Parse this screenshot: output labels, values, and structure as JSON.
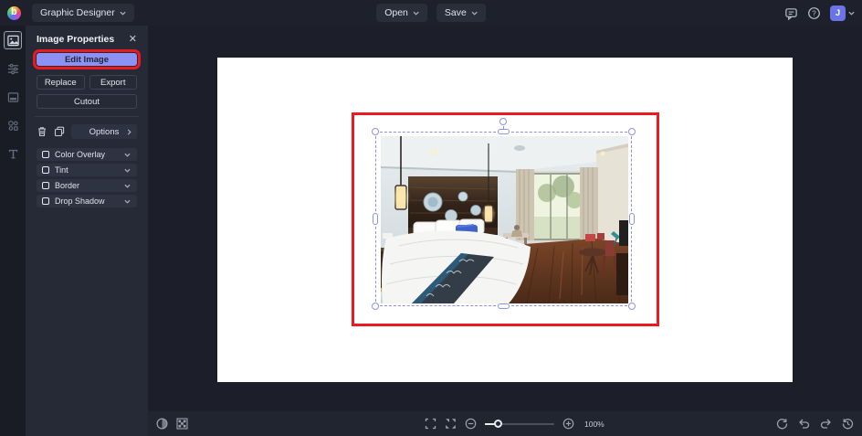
{
  "topbar": {
    "mode_label": "Graphic Designer",
    "open_label": "Open",
    "save_label": "Save",
    "avatar_initial": "J"
  },
  "sidebar": {
    "items": [
      {
        "name": "image-manager",
        "active": true
      },
      {
        "name": "edit",
        "active": false
      },
      {
        "name": "image-library",
        "active": false
      },
      {
        "name": "graphics",
        "active": false
      },
      {
        "name": "text",
        "active": false
      }
    ]
  },
  "panel": {
    "title": "Image Properties",
    "close_label": "✕",
    "edit_image_label": "Edit Image",
    "replace_label": "Replace",
    "export_label": "Export",
    "cutout_label": "Cutout",
    "options_label": "Options",
    "toggles": [
      {
        "label": "Color Overlay",
        "checked": false
      },
      {
        "label": "Tint",
        "checked": false
      },
      {
        "label": "Border",
        "checked": false
      },
      {
        "label": "Drop Shadow",
        "checked": false
      }
    ]
  },
  "bottombar": {
    "zoom_level": "100%"
  },
  "colors": {
    "accent_button": "#8b92f3",
    "annotation_red": "#ec1a1e",
    "selection_blue": "#8a93e8",
    "canvas_white": "#ffffff",
    "chrome_dark": "#1e212c"
  }
}
